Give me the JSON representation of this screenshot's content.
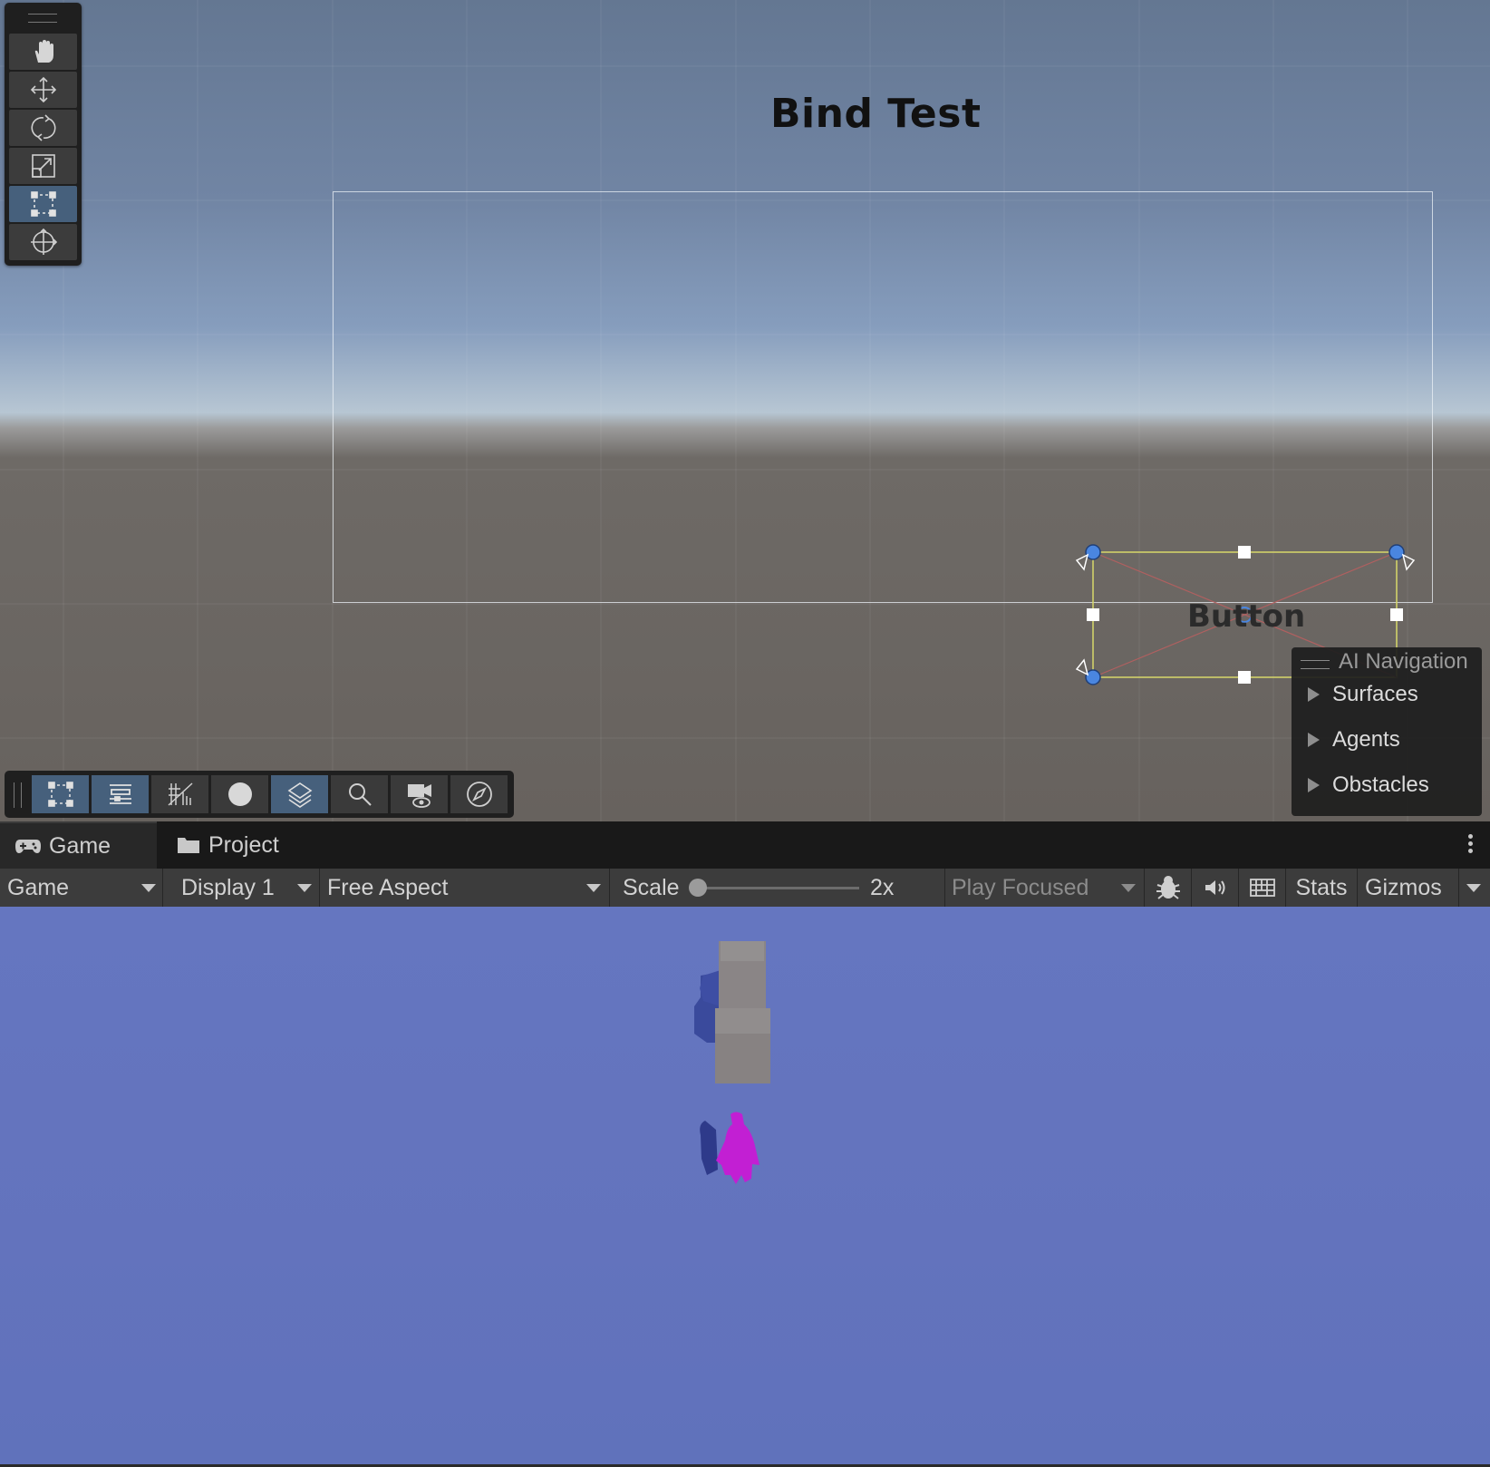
{
  "scene": {
    "title": "Bind Test",
    "button_text": "Button",
    "tools": [
      {
        "name": "hand-tool-icon",
        "active": false
      },
      {
        "name": "move-tool-icon",
        "active": false
      },
      {
        "name": "rotate-tool-icon",
        "active": false
      },
      {
        "name": "scale-tool-icon",
        "active": false
      },
      {
        "name": "rect-tool-icon",
        "active": true
      },
      {
        "name": "transform-tool-icon",
        "active": false
      }
    ],
    "overlay_buttons": [
      {
        "name": "rect-overlay-icon",
        "active": true
      },
      {
        "name": "ui-overlay-icon",
        "active": true
      },
      {
        "name": "grid-overlay-icon",
        "active": false
      },
      {
        "name": "shading-overlay-icon",
        "active": false
      },
      {
        "name": "layer-overlay-icon",
        "active": true
      },
      {
        "name": "search-overlay-icon",
        "active": false
      },
      {
        "name": "camera-overlay-icon",
        "active": false
      },
      {
        "name": "compass-overlay-icon",
        "active": false
      }
    ]
  },
  "ai_navigation": {
    "title": "AI Navigation",
    "items": [
      "Surfaces",
      "Agents",
      "Obstacles"
    ]
  },
  "tabs": {
    "game": "Game",
    "project": "Project"
  },
  "game_toolbar": {
    "mode": "Game",
    "display": "Display 1",
    "aspect": "Free Aspect",
    "scale_label": "Scale",
    "scale_value": "2x",
    "play_mode": "Play Focused",
    "stats": "Stats",
    "gizmos": "Gizmos"
  },
  "colors": {
    "active_tool": "#46607c",
    "game_background": "#6373bd",
    "character": "#c21fd3"
  }
}
